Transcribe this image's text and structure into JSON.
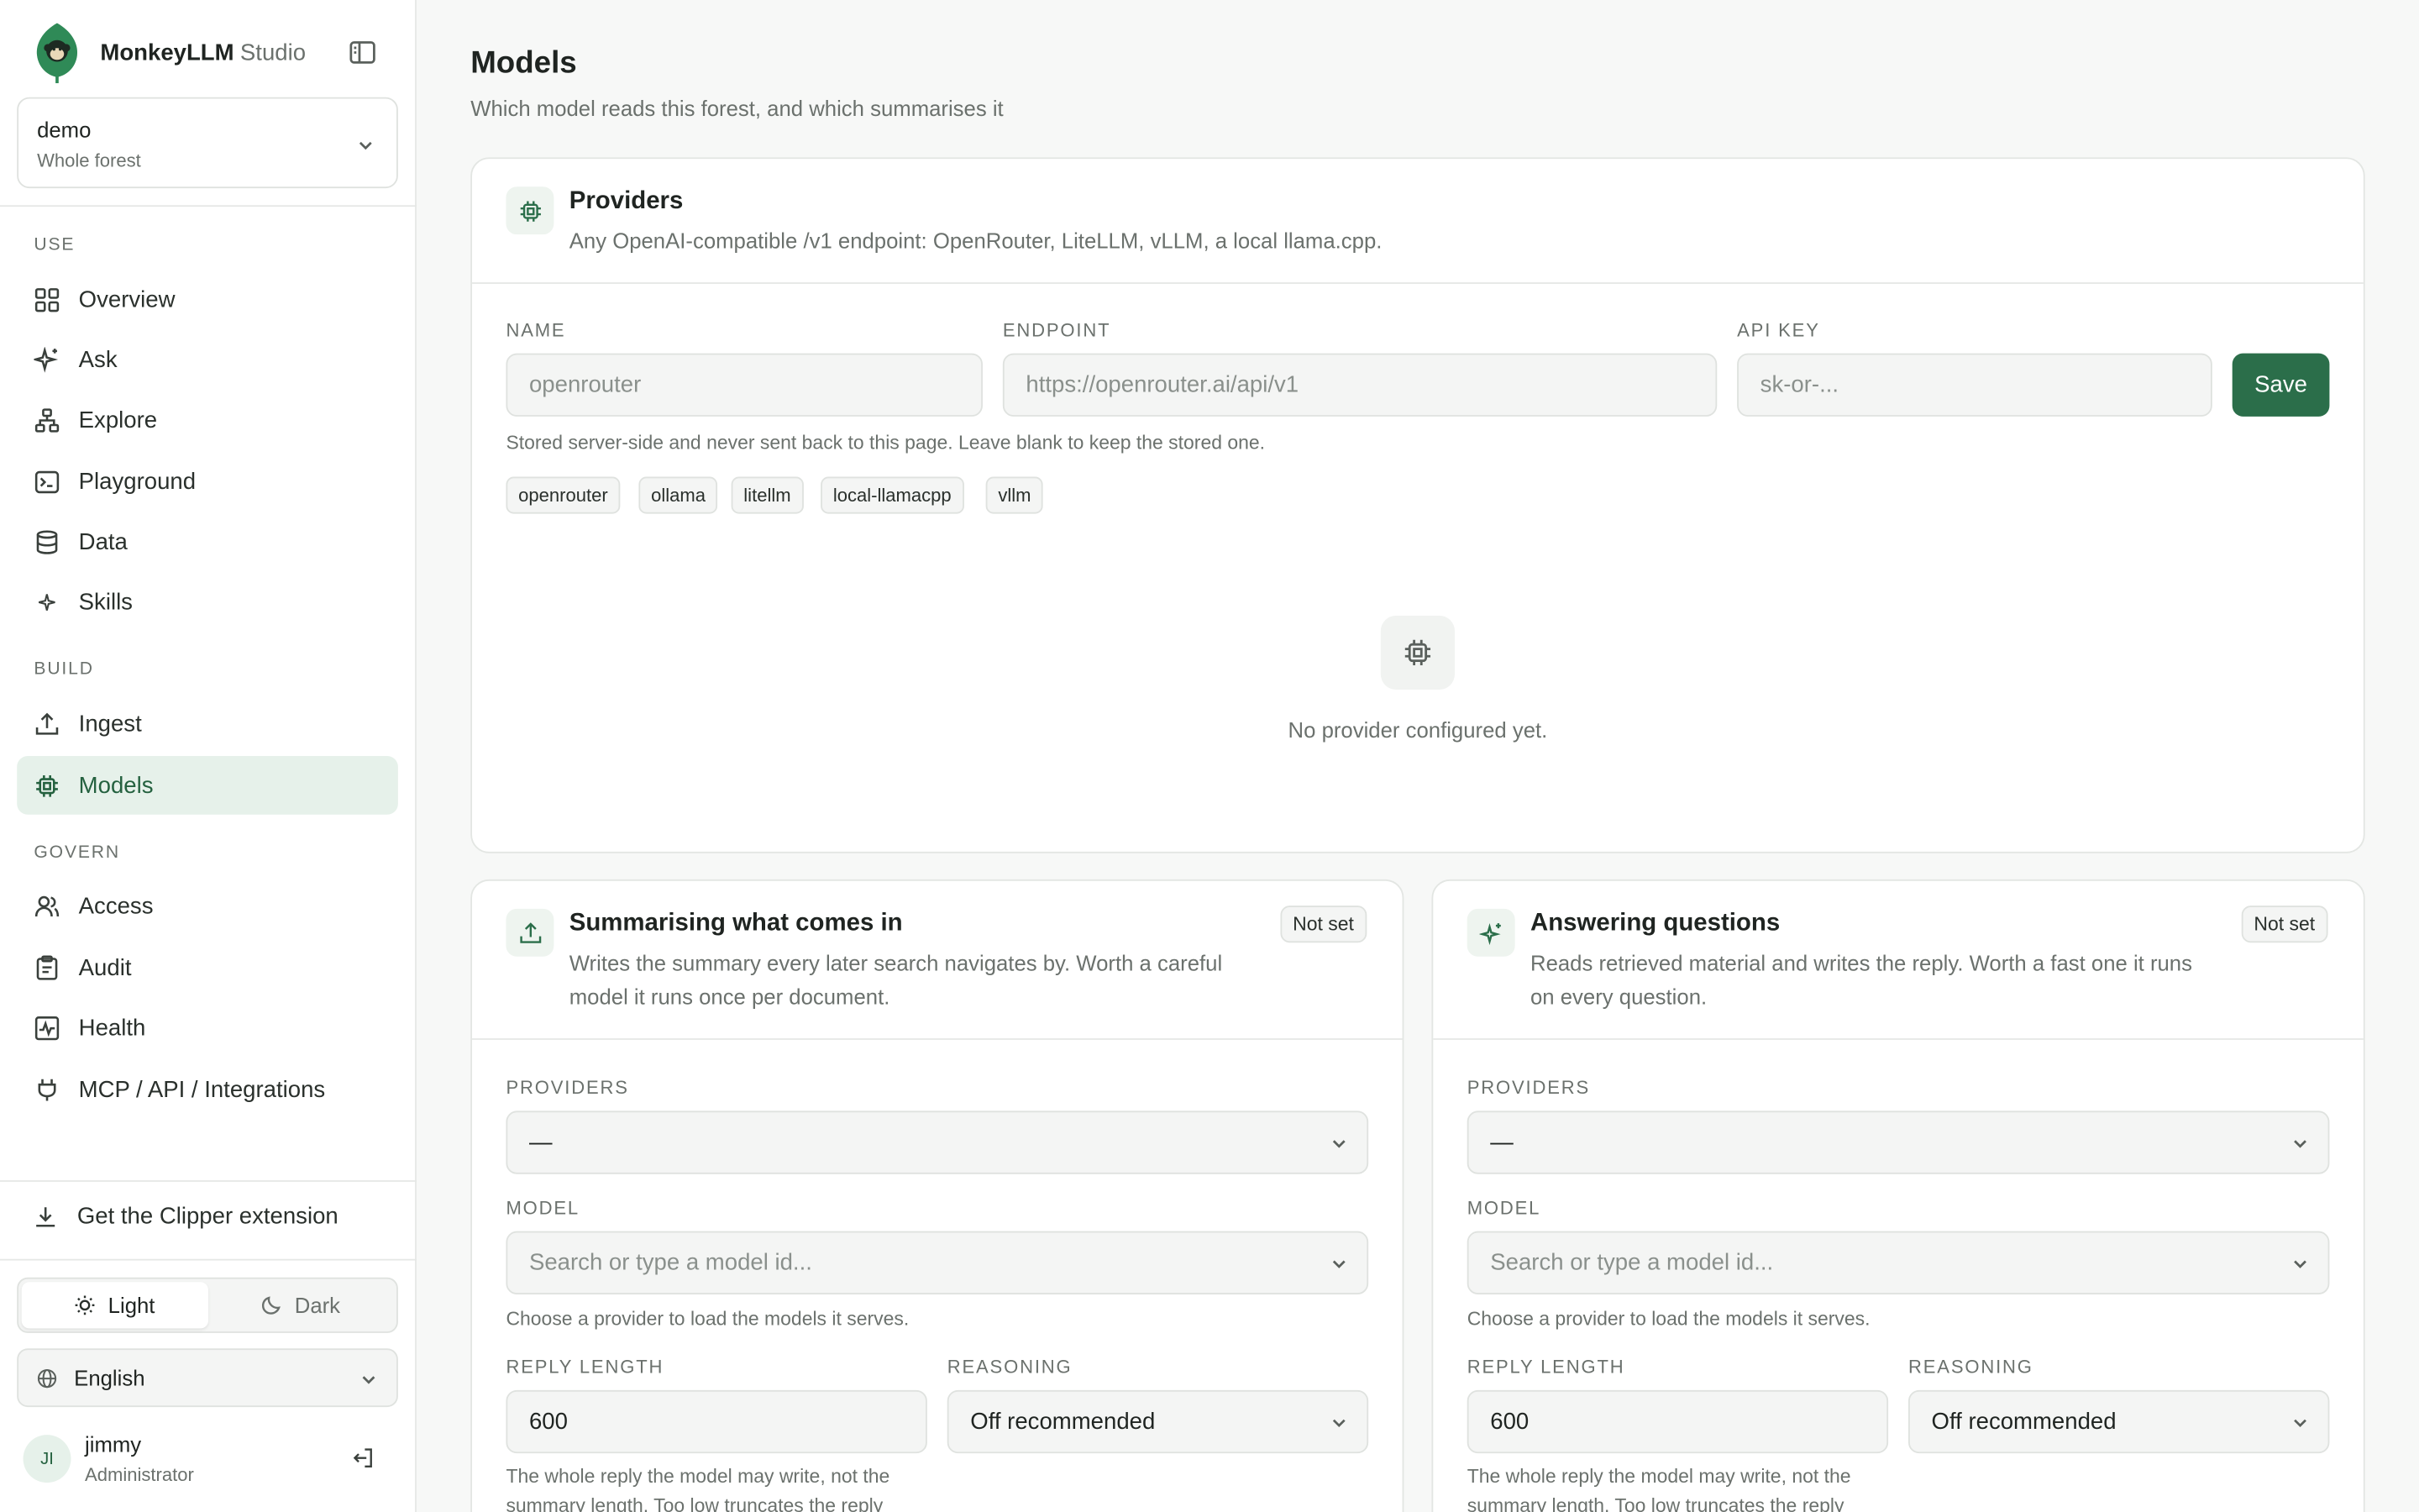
{
  "app": {
    "name": "MonkeyLLM",
    "name_suffix": "Studio"
  },
  "workspace": {
    "name": "demo",
    "scope": "Whole forest"
  },
  "nav": {
    "use_label": "USE",
    "use_items": [
      {
        "label": "Overview",
        "icon": "grid-icon"
      },
      {
        "label": "Ask",
        "icon": "sparkle-icon"
      },
      {
        "label": "Explore",
        "icon": "hierarchy-icon"
      },
      {
        "label": "Playground",
        "icon": "terminal-icon"
      },
      {
        "label": "Data",
        "icon": "database-icon"
      },
      {
        "label": "Skills",
        "icon": "star-icon"
      }
    ],
    "build_label": "BUILD",
    "build_items": [
      {
        "label": "Ingest",
        "icon": "upload-icon"
      },
      {
        "label": "Models",
        "icon": "chip-icon",
        "active": true
      }
    ],
    "govern_label": "GOVERN",
    "govern_items": [
      {
        "label": "Access",
        "icon": "users-icon"
      },
      {
        "label": "Audit",
        "icon": "clipboard-icon"
      },
      {
        "label": "Health",
        "icon": "pulse-icon"
      },
      {
        "label": "MCP / API / Integrations",
        "icon": "plug-icon"
      }
    ]
  },
  "sidebar_footer": {
    "clipper": "Get the Clipper extension",
    "theme_light": "Light",
    "theme_dark": "Dark",
    "theme_selected": "Light",
    "language": "English",
    "user_initials": "JI",
    "user_name": "jimmy",
    "user_role": "Administrator"
  },
  "page": {
    "title": "Models",
    "subtitle": "Which model reads this forest, and which summarises it"
  },
  "providers": {
    "title": "Providers",
    "description": "Any OpenAI-compatible /v1 endpoint: OpenRouter, LiteLLM, vLLM, a local llama.cpp.",
    "name_label": "NAME",
    "name_placeholder": "openrouter",
    "endpoint_label": "ENDPOINT",
    "endpoint_placeholder": "https://openrouter.ai/api/v1",
    "api_key_label": "API KEY",
    "api_key_placeholder": "sk-or-...",
    "save_label": "Save",
    "hint": "Stored server-side and never sent back to this page. Leave blank to keep the stored one.",
    "presets": [
      "openrouter",
      "ollama",
      "litellm",
      "local-llamacpp",
      "vllm"
    ],
    "empty_text": "No provider configured yet."
  },
  "summarising": {
    "title": "Summarising what comes in",
    "description_1": "Writes the summary every later search navigates by. Worth a careful",
    "description_2": "model it runs once per document.",
    "status": "Not set",
    "providers_label": "PROVIDERS",
    "providers_value": "—",
    "model_label": "MODEL",
    "model_placeholder": "Search or type a model id...",
    "model_hint": "Choose a provider to load the models it serves.",
    "reply_length_label": "REPLY LENGTH",
    "reply_length_value": "600",
    "reasoning_label": "REASONING",
    "reasoning_value": "Off recommended",
    "reply_hint_1": "The whole reply the model may write, not the",
    "reply_hint_2": "summary length. Too low truncates the reply"
  },
  "answering": {
    "title": "Answering questions",
    "description_1": "Reads retrieved material and writes the reply. Worth a fast one it runs",
    "description_2": "on every question.",
    "status": "Not set",
    "providers_label": "PROVIDERS",
    "providers_value": "—",
    "model_label": "MODEL",
    "model_placeholder": "Search or type a model id...",
    "model_hint": "Choose a provider to load the models it serves.",
    "reply_length_label": "REPLY LENGTH",
    "reply_length_value": "600",
    "reasoning_label": "REASONING",
    "reasoning_value": "Off recommended",
    "reply_hint_1": "The whole reply the model may write, not the",
    "reply_hint_2": "summary length. Too low truncates the reply"
  },
  "colors": {
    "accent": "#2b6e4a",
    "active_bg": "#e6f1ea",
    "muted_text": "#6b716d"
  }
}
